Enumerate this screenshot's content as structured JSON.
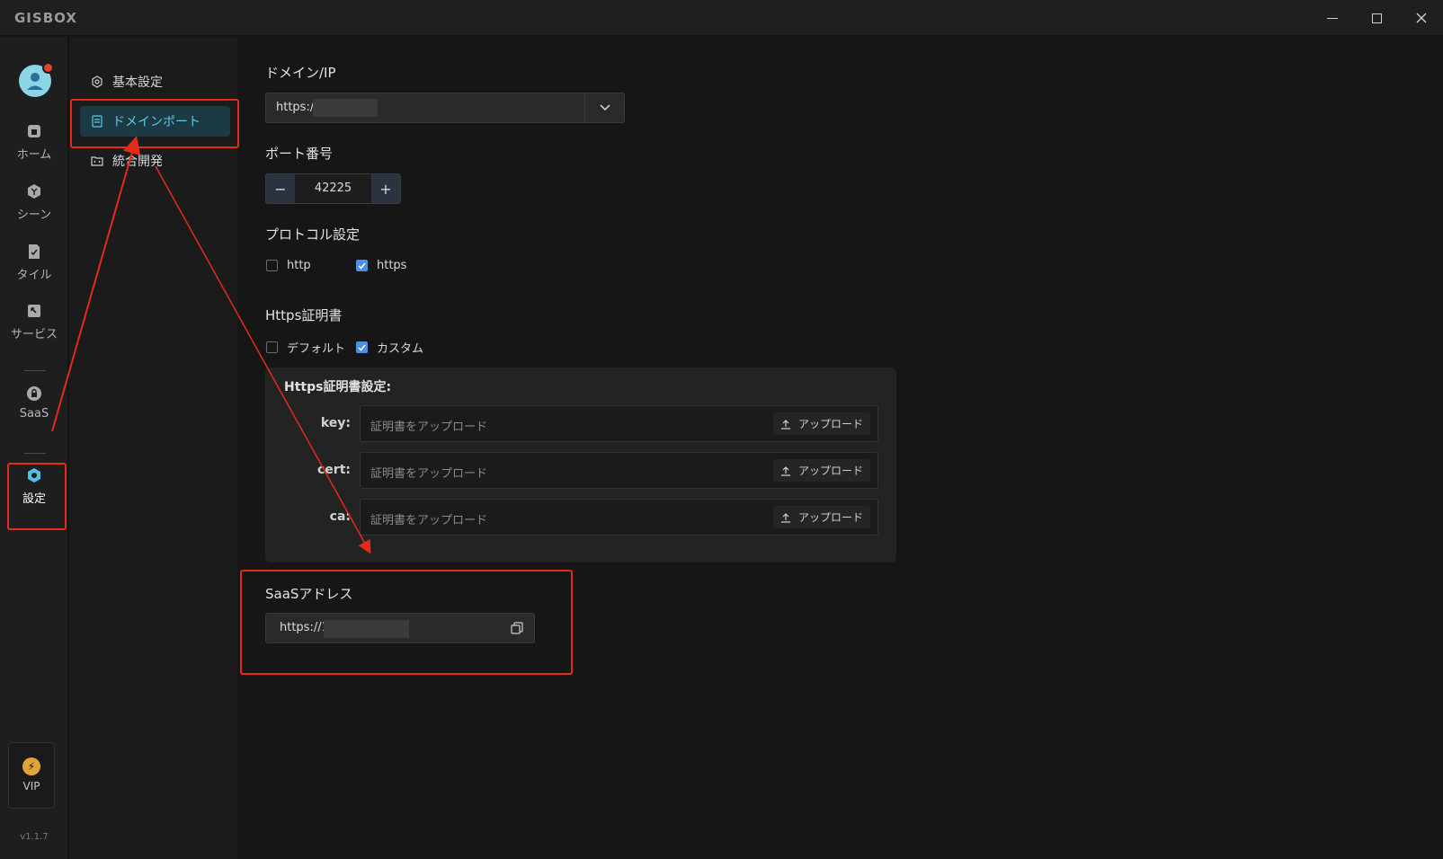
{
  "app": {
    "logo": "GISBOX",
    "version": "v1.1.7"
  },
  "window": {
    "minimize": "minimize",
    "maximize": "maximize",
    "close": "close"
  },
  "rail": {
    "items": [
      {
        "label": "ホーム",
        "icon": "home-icon"
      },
      {
        "label": "シーン",
        "icon": "scene-icon"
      },
      {
        "label": "タイル",
        "icon": "tile-icon"
      },
      {
        "label": "サービス",
        "icon": "service-icon"
      },
      {
        "label": "SaaS",
        "icon": "saas-icon"
      },
      {
        "label": "設定",
        "icon": "settings-icon",
        "active": true
      }
    ],
    "vip_label": "VIP"
  },
  "subnav": {
    "items": [
      {
        "label": "基本設定",
        "icon": "gear-icon"
      },
      {
        "label": "ドメインポート",
        "icon": "domain-icon",
        "active": true
      },
      {
        "label": "統合開発",
        "icon": "code-icon"
      }
    ]
  },
  "domain": {
    "label": "ドメイン/IP",
    "value": "https:/"
  },
  "port": {
    "label": "ポート番号",
    "value": "42225",
    "minus": "−",
    "plus": "+"
  },
  "protocol": {
    "label": "プロトコル設定",
    "options": [
      {
        "label": "http",
        "checked": false
      },
      {
        "label": "https",
        "checked": true
      }
    ]
  },
  "https_cert": {
    "label": "Https証明書",
    "options": [
      {
        "label": "デフォルト",
        "checked": false
      },
      {
        "label": "カスタム",
        "checked": true
      }
    ],
    "panel_title": "Https証明書設定:",
    "fields": [
      {
        "label": "key:",
        "placeholder": "証明書をアップロード",
        "button": "アップロード"
      },
      {
        "label": "cert:",
        "placeholder": "証明書をアップロード",
        "button": "アップロード"
      },
      {
        "label": "ca:",
        "placeholder": "証明書をアップロード",
        "button": "アップロード"
      }
    ]
  },
  "saas": {
    "label": "SaaSアドレス",
    "value": "https://1"
  },
  "colors": {
    "accent": "#5ec8e8",
    "annotation": "#e52a1c",
    "checkbox": "#4c8fe8"
  }
}
